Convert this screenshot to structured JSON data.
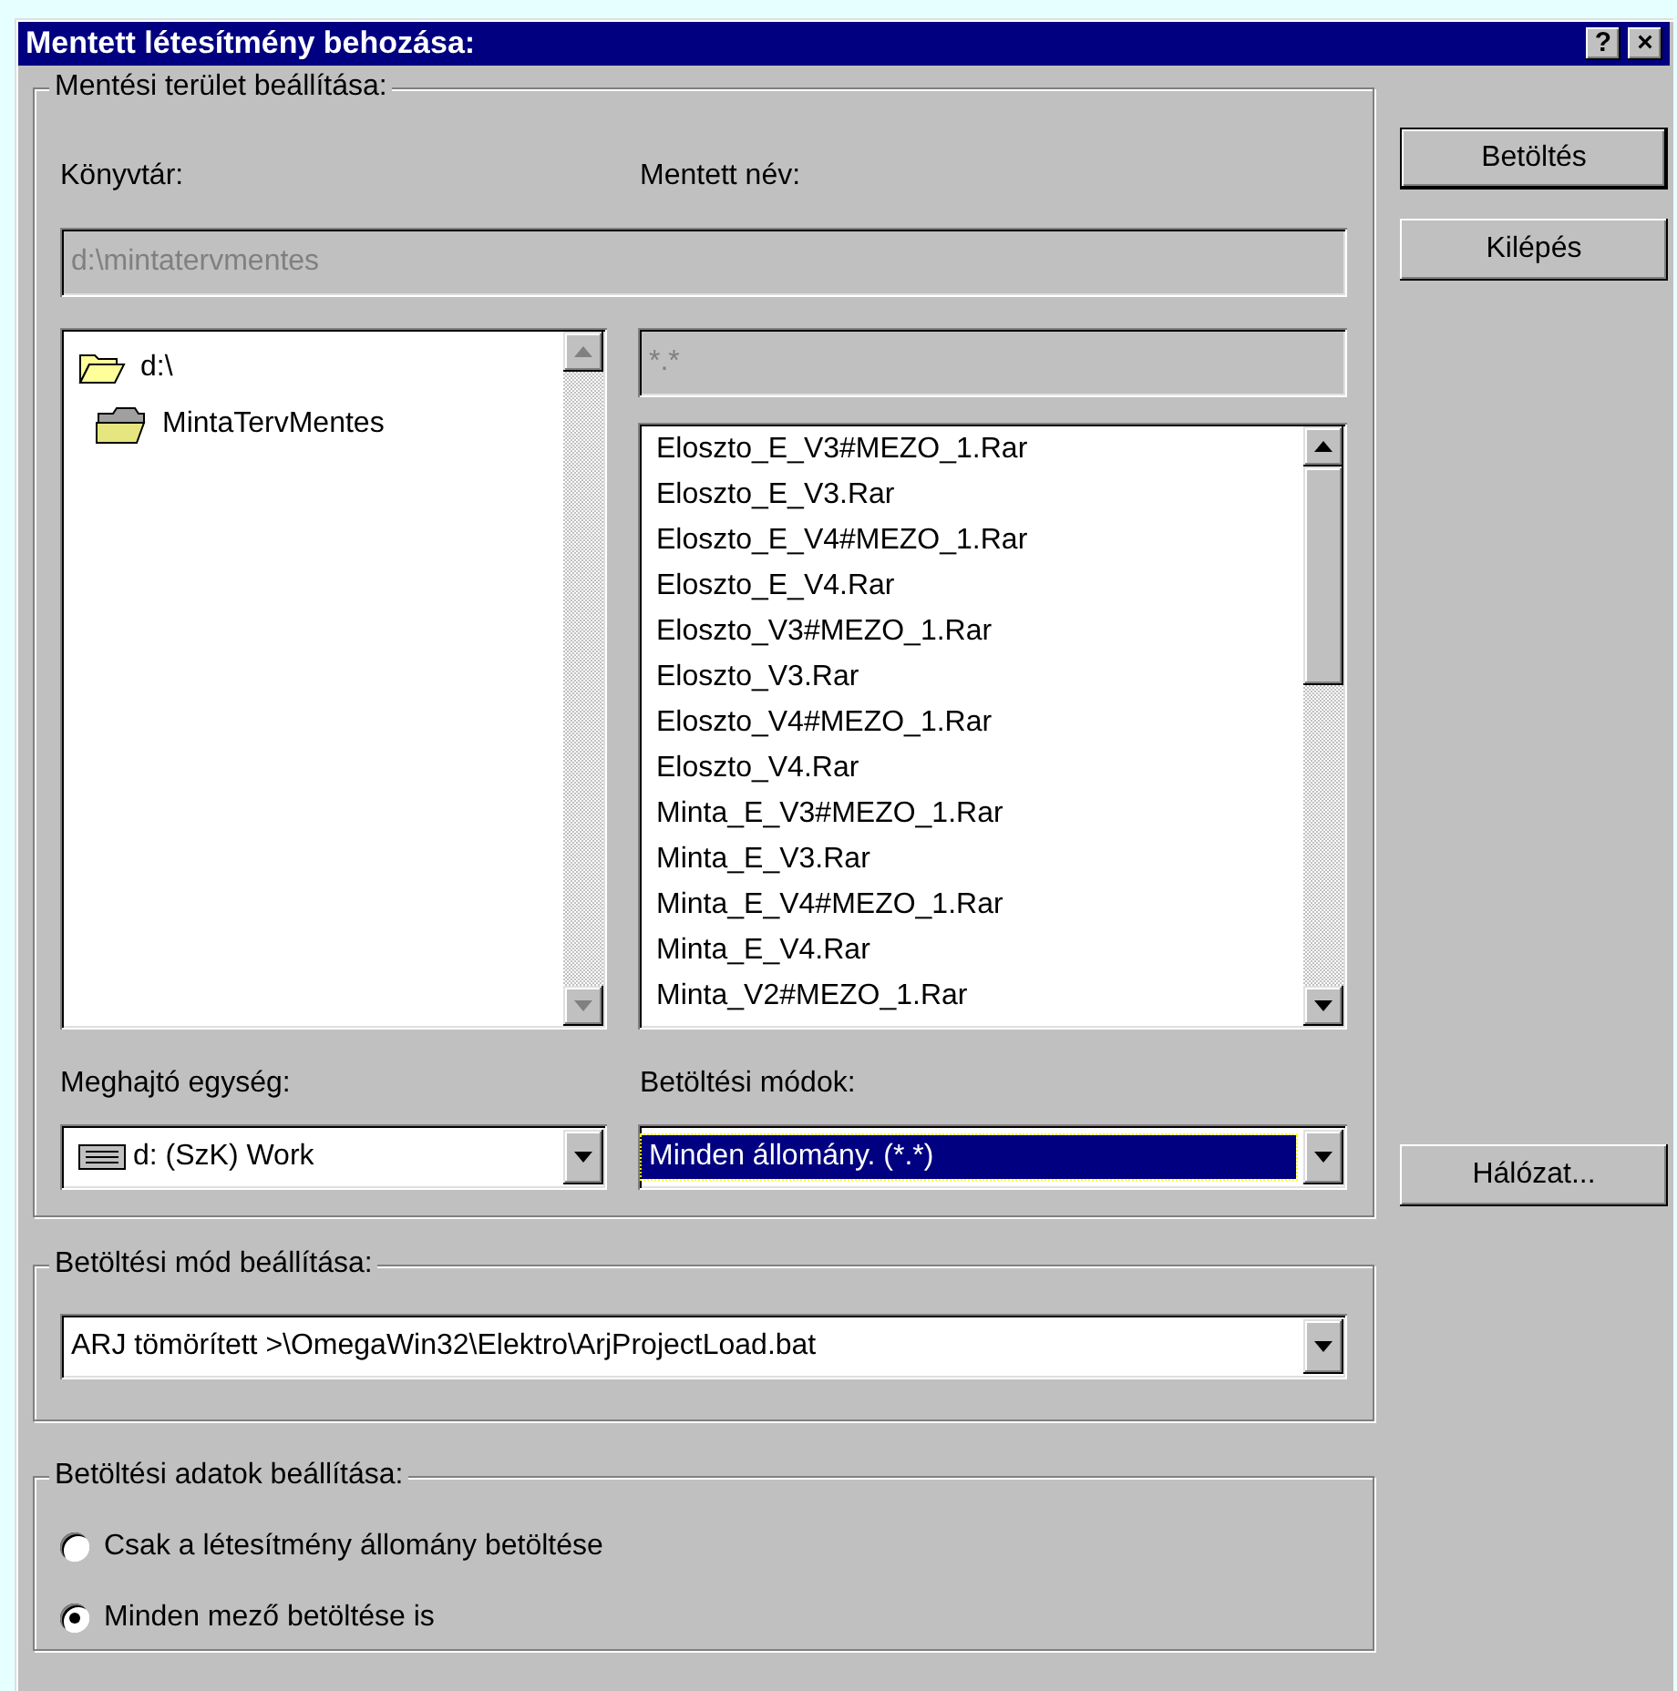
{
  "window": {
    "title": "Mentett létesítmény behozása:",
    "help": "?",
    "close": "×"
  },
  "save_area": {
    "legend": "Mentési terület beállítása:",
    "directory_label": "Könyvtár:",
    "name_label": "Mentett név:",
    "directory_field": {
      "value": "d:\\mintatervmentes",
      "disabled": true
    },
    "folder_tree": [
      {
        "label": "d:\\",
        "open": true,
        "children": [
          {
            "label": "MintaTervMentes",
            "open": false
          }
        ]
      }
    ],
    "filter_field": {
      "value": "*.*",
      "disabled": true
    },
    "files": [
      "Eloszto_E_V3#MEZO_1.Rar",
      "Eloszto_E_V3.Rar",
      "Eloszto_E_V4#MEZO_1.Rar",
      "Eloszto_E_V4.Rar",
      "Eloszto_V3#MEZO_1.Rar",
      "Eloszto_V3.Rar",
      "Eloszto_V4#MEZO_1.Rar",
      "Eloszto_V4.Rar",
      "Minta_E_V3#MEZO_1.Rar",
      "Minta_E_V3.Rar",
      "Minta_E_V4#MEZO_1.Rar",
      "Minta_E_V4.Rar",
      "Minta_V2#MEZO_1.Rar"
    ],
    "drive_label": "Meghajtó egység:",
    "modes_label": "Betöltési módok:",
    "drive_combo": {
      "value": "d: (SzK) Work"
    },
    "modes_combo": {
      "value": "Minden állomány. (*.*)",
      "focused": true
    }
  },
  "buttons": [
    {
      "label": "Betöltés",
      "default": true
    },
    {
      "label": "Kilépés",
      "default": false
    }
  ],
  "network_button": {
    "label": "Hálózat..."
  },
  "load_mode": {
    "legend": "Betöltési mód beállítása:",
    "combo": {
      "value": "ARJ tömörített >\\OmegaWin32\\Elektro\\ArjProjectLoad.bat"
    }
  },
  "load_data": {
    "legend": "Betöltési adatok beállítása:",
    "options": [
      {
        "label": "Csak a létesítmény állomány betöltése",
        "selected": false
      },
      {
        "label": "Minden mező betöltése is",
        "selected": true
      }
    ]
  }
}
